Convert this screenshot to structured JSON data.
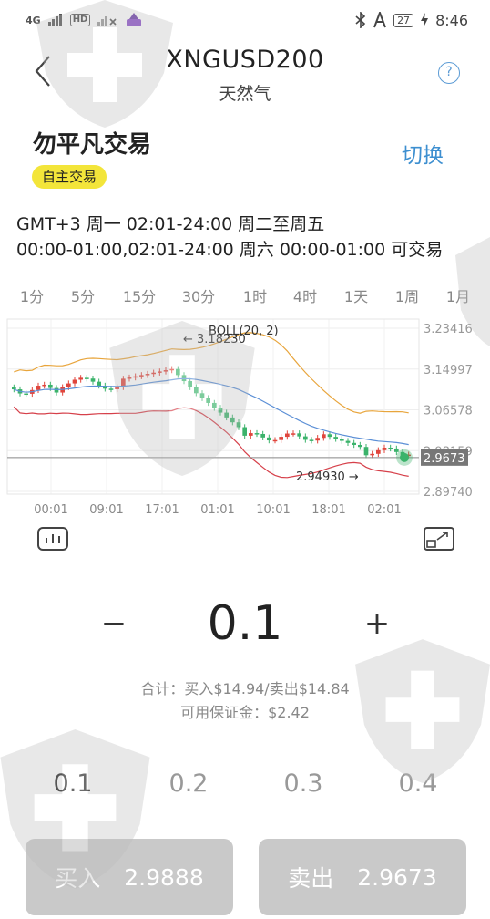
{
  "status": {
    "network": "4G",
    "hd": "HD",
    "battery": "27",
    "time": "8:46"
  },
  "header": {
    "title": "XNGUSD200",
    "subtitle": "天然气",
    "help": "?"
  },
  "mode": {
    "title": "勿平凡交易",
    "switch_label": "切换",
    "badge": "自主交易"
  },
  "trading_hours": {
    "line1": "GMT+3 周一 02:01-24:00  周二至周五",
    "line2": "00:00-01:00,02:01-24:00  周六 00:00-01:00 可交易"
  },
  "timeframes": {
    "active": "1时",
    "items": [
      "1分",
      "5分",
      "15分",
      "30分",
      "1时",
      "4时",
      "1天",
      "1周",
      "1月"
    ]
  },
  "chart_data": {
    "type": "candlestick",
    "indicator": "BOLL(20, 2)",
    "annotations": {
      "high": "← 3.18230",
      "low": "2.94930 →"
    },
    "y_ticks": [
      "3.23416",
      "3.14997",
      "3.06578",
      "2.98159",
      "2.89740"
    ],
    "ylim": [
      2.8974,
      3.23416
    ],
    "x_ticks": [
      "00:01",
      "09:01",
      "17:01",
      "01:01",
      "10:01",
      "18:01",
      "02:01"
    ],
    "current_price": "2.9673",
    "colors": {
      "up": "#e0453c",
      "down": "#3bb36b",
      "upper_band": "#e8a53c",
      "middle_band": "#5b8fd6",
      "lower_band": "#d6404a"
    }
  },
  "quantity": {
    "minus": "−",
    "value": "0.1",
    "plus": "+"
  },
  "summary": {
    "total": "合计：买入$14.94/卖出$14.84",
    "margin": "可用保证金：$2.42"
  },
  "lots": {
    "active": "0.1",
    "items": [
      "0.1",
      "0.2",
      "0.3",
      "0.4"
    ]
  },
  "actions": {
    "buy_label": "买入",
    "buy_price": "2.9888",
    "sell_label": "卖出",
    "sell_price": "2.9673"
  }
}
